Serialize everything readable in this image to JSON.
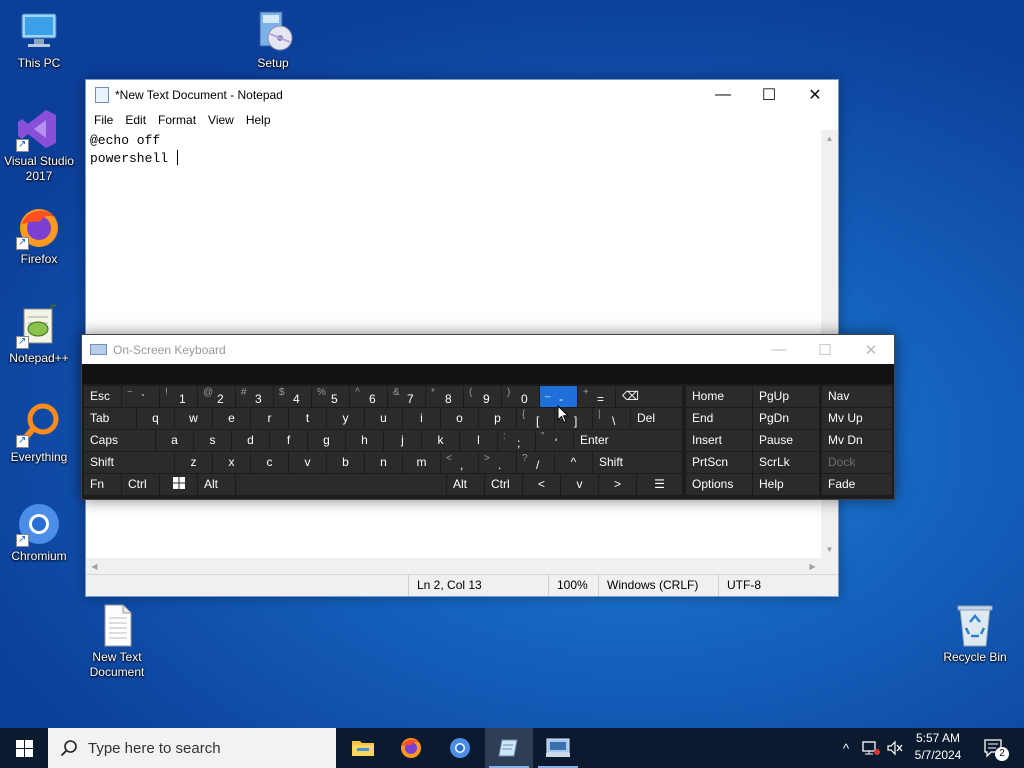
{
  "desktop": {
    "icons": {
      "this_pc": "This PC",
      "setup": "Setup",
      "visual_studio": "Visual Studio 2017",
      "firefox": "Firefox",
      "notepadpp": "Notepad++",
      "everything": "Everything",
      "chromium": "Chromium",
      "new_text_document": "New Text Document",
      "recycle_bin": "Recycle Bin"
    }
  },
  "notepad": {
    "title": "*New Text Document - Notepad",
    "menu": [
      "File",
      "Edit",
      "Format",
      "View",
      "Help"
    ],
    "content_lines": [
      "@echo off",
      "powershell "
    ],
    "status": {
      "position": "Ln 2, Col 13",
      "zoom": "100%",
      "line_ending": "Windows (CRLF)",
      "encoding": "UTF-8"
    }
  },
  "osk": {
    "title": "On-Screen Keyboard",
    "row1": [
      {
        "s": "",
        "m": "Esc"
      },
      {
        "s": "~",
        "m": "`"
      },
      {
        "s": "!",
        "m": "1"
      },
      {
        "s": "@",
        "m": "2"
      },
      {
        "s": "#",
        "m": "3"
      },
      {
        "s": "$",
        "m": "4"
      },
      {
        "s": "%",
        "m": "5"
      },
      {
        "s": "^",
        "m": "6"
      },
      {
        "s": "&",
        "m": "7"
      },
      {
        "s": "*",
        "m": "8"
      },
      {
        "s": "(",
        "m": "9"
      },
      {
        "s": ")",
        "m": "0"
      },
      {
        "s": "_",
        "m": "-"
      },
      {
        "s": "+",
        "m": "="
      },
      {
        "s": "",
        "m": "⌫"
      }
    ],
    "row2": [
      "Tab",
      "q",
      "w",
      "e",
      "r",
      "t",
      "y",
      "u",
      "i",
      "o",
      "p"
    ],
    "row2_sym": [
      {
        "s": "{",
        "m": "["
      },
      {
        "s": "}",
        "m": "]"
      },
      {
        "s": "|",
        "m": "\\"
      }
    ],
    "row2_end": "Del",
    "row3": [
      "Caps",
      "a",
      "s",
      "d",
      "f",
      "g",
      "h",
      "j",
      "k",
      "l"
    ],
    "row3_sym": [
      {
        "s": ":",
        "m": ";"
      },
      {
        "s": "\"",
        "m": "'"
      }
    ],
    "row3_end": "Enter",
    "row4": [
      "Shift",
      "z",
      "x",
      "c",
      "v",
      "b",
      "n",
      "m"
    ],
    "row4_sym": [
      {
        "s": "<",
        "m": ","
      },
      {
        "s": ">",
        "m": "."
      },
      {
        "s": "?",
        "m": "/"
      }
    ],
    "row4_up": "^",
    "row4_end": "Shift",
    "row5": {
      "fn": "Fn",
      "ctrl": "Ctrl",
      "alt": "Alt",
      "alt_r": "Alt",
      "ctrl_r": "Ctrl",
      "left": "<",
      "down": "v",
      "right": ">"
    },
    "side": [
      [
        "Home",
        "PgUp",
        "Nav"
      ],
      [
        "End",
        "PgDn",
        "Mv Up"
      ],
      [
        "Insert",
        "Pause",
        "Mv Dn"
      ],
      [
        "PrtScn",
        "ScrLk",
        "Dock"
      ],
      [
        "Options",
        "Help",
        "Fade"
      ]
    ]
  },
  "taskbar": {
    "search_placeholder": "Type here to search",
    "time": "5:57 AM",
    "date": "5/7/2024",
    "notification_count": "2"
  }
}
